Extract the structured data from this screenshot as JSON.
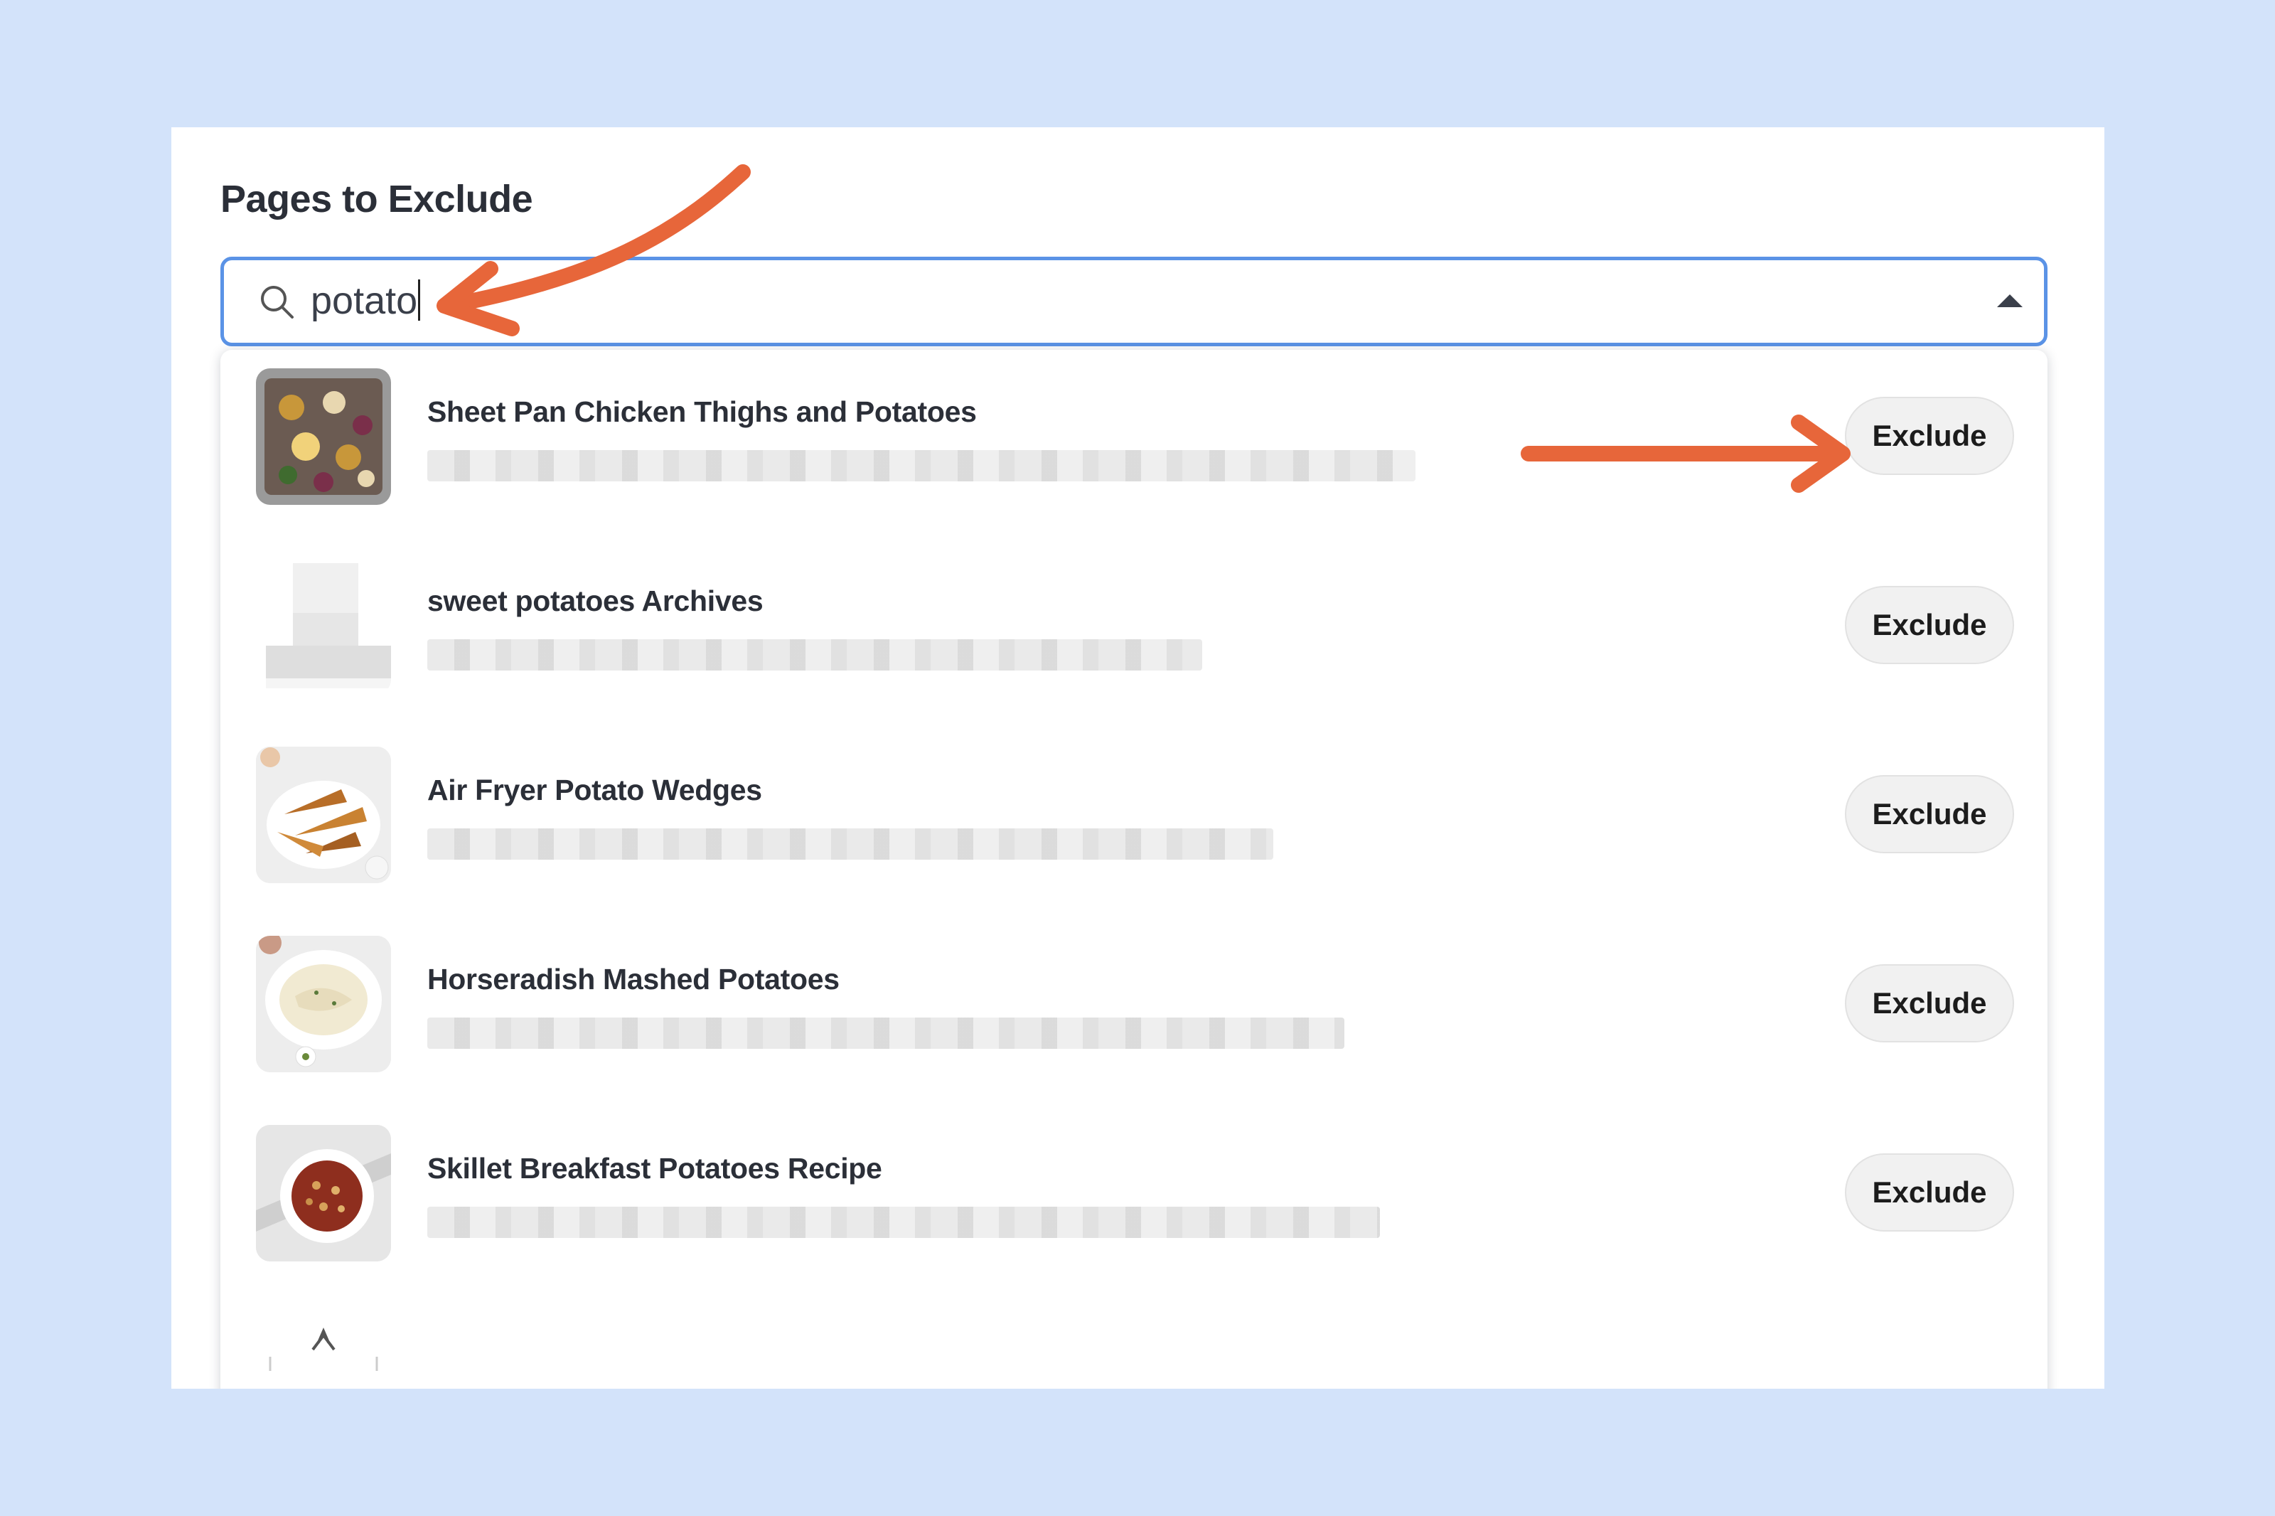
{
  "section": {
    "title": "Pages to Exclude"
  },
  "search": {
    "value": "potato",
    "icon": "search-icon",
    "toggle_icon": "caret-up-icon"
  },
  "results": [
    {
      "title": "Sheet Pan Chicken Thighs and Potatoes",
      "button": "Exclude",
      "thumb": "sheet-pan-thumbnail"
    },
    {
      "title": "sweet potatoes Archives",
      "button": "Exclude",
      "thumb": "placeholder-thumbnail"
    },
    {
      "title": "Air Fryer Potato Wedges",
      "button": "Exclude",
      "thumb": "potato-wedges-thumbnail"
    },
    {
      "title": "Horseradish Mashed Potatoes",
      "button": "Exclude",
      "thumb": "mashed-potatoes-thumbnail"
    },
    {
      "title": "Skillet Breakfast Potatoes Recipe",
      "button": "Exclude",
      "thumb": "breakfast-potatoes-thumbnail"
    }
  ],
  "colors": {
    "page_background": "#d3e3fa",
    "focus_border": "#5b93e6",
    "annotation_arrow": "#e7663a",
    "button_background": "#f1f1f1"
  }
}
